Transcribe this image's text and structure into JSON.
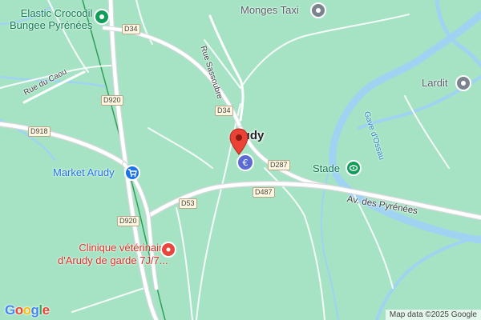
{
  "map": {
    "town": "Arudy",
    "colors": {
      "land": "#a6e3c4",
      "water": "#9fd3f1",
      "road": "#ffffff",
      "road_main": "#d7d8dc",
      "rail": "#2f9e58",
      "marker": "#e64a3c"
    },
    "pois": [
      {
        "name": "Elastic Crocodil Bungee Pyrénées",
        "icon": "green-leisure-icon"
      },
      {
        "name": "Monges Taxi",
        "icon": "gray-place-icon"
      },
      {
        "name": "Lardit",
        "icon": "gray-place-icon"
      },
      {
        "name": "Market Arudy",
        "icon": "shopping-cart-icon"
      },
      {
        "name": "Stade",
        "icon": "stadium-icon"
      },
      {
        "name": "Clinique vétérinaire d'Arudy de garde 7J/7...",
        "icon": "medical-icon"
      }
    ],
    "poi_labels": {
      "elastic_line1": "Elastic Crocodil",
      "elastic_line2": "Bungee Pyrénées",
      "monges": "Monges Taxi",
      "lardit": "Lardit",
      "market": "Market Arudy",
      "stade": "Stade",
      "clinique_line1": "Clinique vétérinaire",
      "clinique_line2": "d'Arudy de garde 7J/7..."
    },
    "streets": {
      "rue_sassoubre": "Rue Sassoubre",
      "rue_du_caou": "Rue du Caou",
      "av_pyrenees": "Av. des Pyrénées"
    },
    "water_labels": {
      "gave": "Gave d'Ossau"
    },
    "shields": {
      "d34_top": "D34",
      "d920_a": "D920",
      "d918": "D918",
      "d34_mid": "D34",
      "d287": "D287",
      "d487": "D487",
      "d53": "D53",
      "d920_b": "D920"
    },
    "branding": {
      "google": "Google",
      "attribution": "Map data ©2025 Google"
    }
  }
}
